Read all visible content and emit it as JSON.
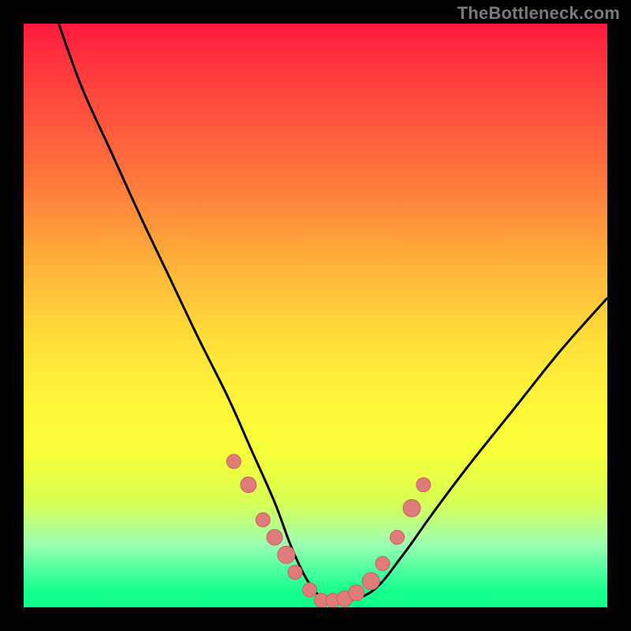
{
  "attribution": "TheBottleneck.com",
  "colors": {
    "frame": "#000000",
    "curve": "#000000",
    "marker_fill": "#e07b7b",
    "marker_stroke": "#c96060",
    "gradient_stops": [
      "#ff1a3e",
      "#ff3a3d",
      "#ff5a3c",
      "#ff843b",
      "#ffb53a",
      "#ffe139",
      "#fff839",
      "#f6ff3a",
      "#d7ff54",
      "#9fffb0",
      "#46ff9f",
      "#18ff8e",
      "#0dff86"
    ]
  },
  "chart_data": {
    "type": "line",
    "title": "",
    "xlabel": "",
    "ylabel": "",
    "xlim": [
      0,
      100
    ],
    "ylim": [
      0,
      100
    ],
    "description": "V-shaped bottleneck curve on a vertical heat gradient. Curve drops from top-left to a flat minimum near center-bottom then rises to the right. Pink circular markers cluster along the lower portion of both arms and the flat minimum.",
    "series": [
      {
        "name": "bottleneck-curve",
        "x": [
          6,
          10,
          15,
          20,
          25,
          30,
          35,
          39,
          43,
          46,
          49,
          52,
          55,
          60,
          65,
          70,
          76,
          84,
          92,
          100
        ],
        "values": [
          100,
          89,
          78,
          67,
          56.5,
          46,
          36,
          27,
          18,
          10,
          4,
          1,
          1,
          3,
          9,
          16,
          24,
          34,
          44,
          53
        ]
      }
    ],
    "markers": {
      "x": [
        36,
        38.5,
        41,
        43,
        45,
        46.5,
        49,
        51,
        53,
        55,
        57,
        59.5,
        61.5,
        64,
        66.5,
        68.5
      ],
      "values": [
        25,
        21,
        15,
        12,
        9,
        6,
        3,
        1.2,
        1.2,
        1.5,
        2.5,
        4.5,
        7.5,
        12,
        17,
        21
      ],
      "r": [
        9,
        10,
        9,
        10,
        11,
        9,
        9,
        9,
        9,
        10,
        10,
        11,
        9,
        9,
        11,
        9
      ]
    }
  }
}
